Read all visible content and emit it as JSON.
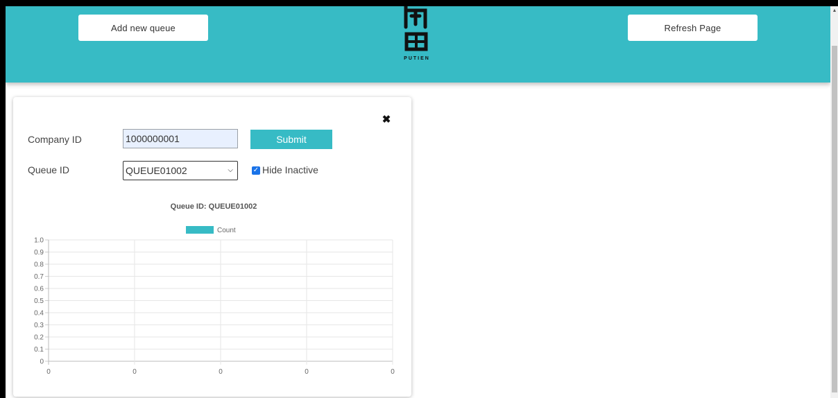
{
  "header": {
    "add_queue_label": "Add new queue",
    "refresh_label": "Refresh Page",
    "logo_text": "PUTIEN",
    "background_color": "#37bbc5"
  },
  "form": {
    "company_label": "Company ID",
    "company_value": "1000000001",
    "submit_label": "Submit",
    "queue_label": "Queue ID",
    "queue_selected": "QUEUE01002",
    "hide_inactive_label": "Hide Inactive",
    "hide_inactive_checked": true,
    "close_icon": "close-icon"
  },
  "chart_data": {
    "type": "bar",
    "title": "Queue ID: QUEUE01002",
    "legend": [
      "Count"
    ],
    "series": [
      {
        "name": "Count",
        "color": "#37bbc5",
        "values": []
      }
    ],
    "x_tick_labels": [
      "0",
      "0",
      "0",
      "0",
      "0"
    ],
    "y_ticks": [
      "0",
      "0.1",
      "0.2",
      "0.3",
      "0.4",
      "0.5",
      "0.6",
      "0.7",
      "0.8",
      "0.9",
      "1.0"
    ],
    "ylim": [
      0,
      1
    ],
    "grid": true,
    "legend_position": "top"
  }
}
